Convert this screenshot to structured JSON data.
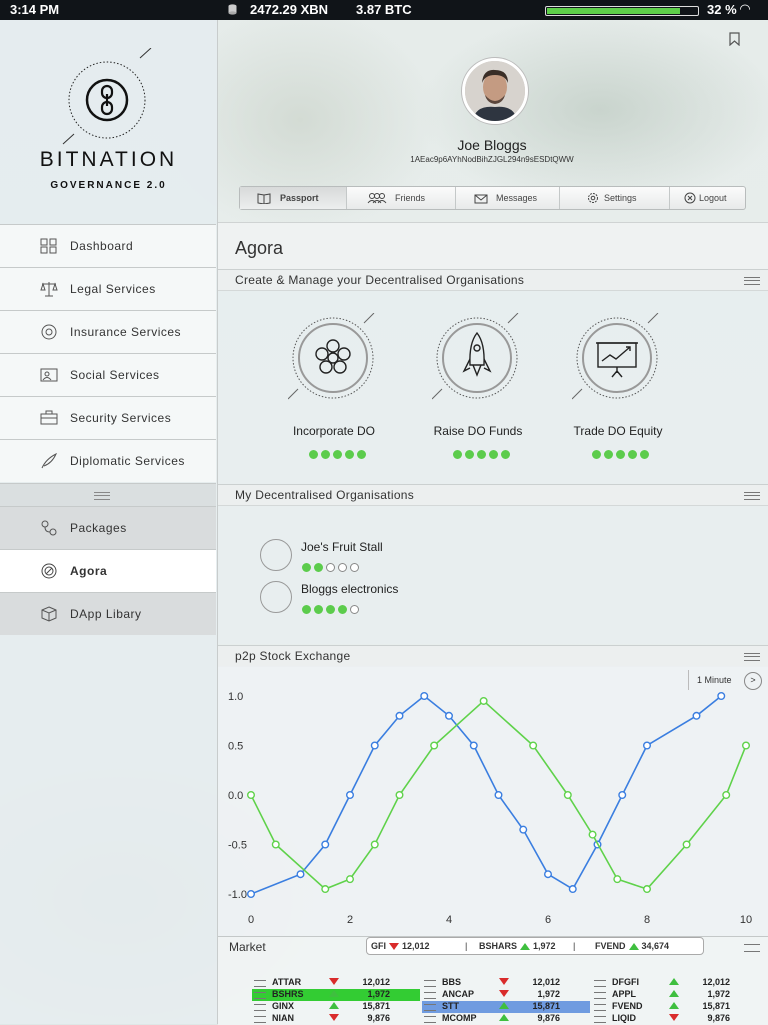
{
  "status": {
    "time": "3:14 PM",
    "xbn": "2472.29 XBN",
    "btc": "3.87 BTC",
    "battery": "32 %",
    "battery_fraction": 0.9
  },
  "brand": {
    "name": "BITNATION",
    "tagline": "GOVERNANCE 2.0"
  },
  "sidebar": {
    "items": [
      {
        "label": "Dashboard",
        "icon": "dashboard-icon"
      },
      {
        "label": "Legal Services",
        "icon": "scales-icon"
      },
      {
        "label": "Insurance Services",
        "icon": "lifebuoy-icon"
      },
      {
        "label": "Social Services",
        "icon": "people-icon"
      },
      {
        "label": "Security Services",
        "icon": "briefcase-icon"
      },
      {
        "label": "Diplomatic Services",
        "icon": "quill-icon"
      }
    ],
    "lower": [
      {
        "label": "Packages",
        "icon": "packages-icon"
      },
      {
        "label": "Agora",
        "icon": "agora-icon"
      },
      {
        "label": "DApp Libary",
        "icon": "cube-icon"
      }
    ]
  },
  "profile": {
    "name": "Joe Bloggs",
    "address": "1AEac9p6AYhNodBihZJGL294n9sESDtQWW"
  },
  "tabs": [
    "Passport",
    "Friends",
    "Messages",
    "Settings",
    "Logout"
  ],
  "agora": {
    "title": "Agora",
    "create_section": "Create & Manage your Decentralised Organisations",
    "actions": [
      {
        "label": "Incorporate DO",
        "icon": "flower-icon",
        "rating": 5
      },
      {
        "label": "Raise DO Funds",
        "icon": "rocket-icon",
        "rating": 5
      },
      {
        "label": "Trade DO Equity",
        "icon": "presentation-chart-icon",
        "rating": 5
      }
    ],
    "my_section": "My Decentralised Organisations",
    "orgs": [
      {
        "name": "Joe's Fruit Stall",
        "rating": 2
      },
      {
        "name": "Bloggs electronics",
        "rating": 4
      }
    ],
    "stock_section": "p2p Stock Exchange",
    "interval": "1 Minute",
    "interval_button": ">"
  },
  "chart_data": {
    "type": "line",
    "x": [
      0,
      0.5,
      1,
      1.5,
      2,
      2.5,
      3,
      3.5,
      4,
      4.5,
      5,
      5.5,
      6,
      6.5,
      7,
      7.5,
      8,
      8.5,
      9,
      9.5,
      10
    ],
    "series": [
      {
        "values": [
          -1.0,
          -0.8,
          -0.5,
          0.0,
          0.5,
          0.8,
          1.0,
          0.8,
          0.5,
          0.0,
          -0.35,
          -0.8,
          -0.95,
          -0.5,
          0.0,
          0.5,
          0.8,
          1.0
        ],
        "x": [
          0,
          1,
          1.5,
          2,
          2.5,
          3,
          3.5,
          4,
          4.5,
          5,
          5.5,
          6,
          6.5,
          7,
          7.5,
          8,
          9,
          9.5
        ]
      },
      {
        "values": [
          0.0,
          -0.5,
          -0.95,
          -0.85,
          -0.5,
          0.0,
          0.5,
          0.95,
          0.5,
          0.0,
          -0.4,
          -0.85,
          -0.95,
          -0.5,
          0.0,
          0.5
        ],
        "x": [
          0,
          0.5,
          1.5,
          2,
          2.5,
          3,
          3.7,
          4.7,
          5.7,
          6.4,
          6.9,
          7.4,
          8.0,
          8.8,
          9.6,
          10
        ]
      }
    ],
    "colors": [
      "#3a7ee0",
      "#5fd24a"
    ],
    "xlim": [
      0,
      10
    ],
    "ylim": [
      -1.0,
      1.0
    ],
    "xticks": [
      0,
      2,
      4,
      6,
      8,
      10
    ],
    "yticks": [
      "1.0",
      "0.5",
      "0.0",
      "-0.5",
      "-1.0"
    ]
  },
  "market": {
    "title": "Market",
    "ticker": [
      {
        "sym": "GFI",
        "dir": "down",
        "val": "12,012"
      },
      {
        "sym": "BSHARS",
        "dir": "up",
        "val": "1,972"
      },
      {
        "sym": "FVEND",
        "dir": "up",
        "val": "34,674"
      }
    ],
    "columns": [
      [
        {
          "sym": "ATTAR",
          "dir": "down",
          "val": "12,012"
        },
        {
          "sym": "BSHRS",
          "dir": "up",
          "val": "1,972",
          "hl": "green"
        },
        {
          "sym": "GINX",
          "dir": "up",
          "val": "15,871"
        },
        {
          "sym": "NIAN",
          "dir": "down",
          "val": "9,876"
        }
      ],
      [
        {
          "sym": "BBS",
          "dir": "down",
          "val": "12,012"
        },
        {
          "sym": "ANCAP",
          "dir": "down",
          "val": "1,972"
        },
        {
          "sym": "STT",
          "dir": "up",
          "val": "15,871",
          "hl": "blue"
        },
        {
          "sym": "MCOMP",
          "dir": "up",
          "val": "9,876"
        }
      ],
      [
        {
          "sym": "DFGFI",
          "dir": "up",
          "val": "12,012"
        },
        {
          "sym": "APPL",
          "dir": "up",
          "val": "1,972"
        },
        {
          "sym": "FVEND",
          "dir": "up",
          "val": "15,871"
        },
        {
          "sym": "LIQID",
          "dir": "down",
          "val": "9,876"
        }
      ]
    ]
  }
}
